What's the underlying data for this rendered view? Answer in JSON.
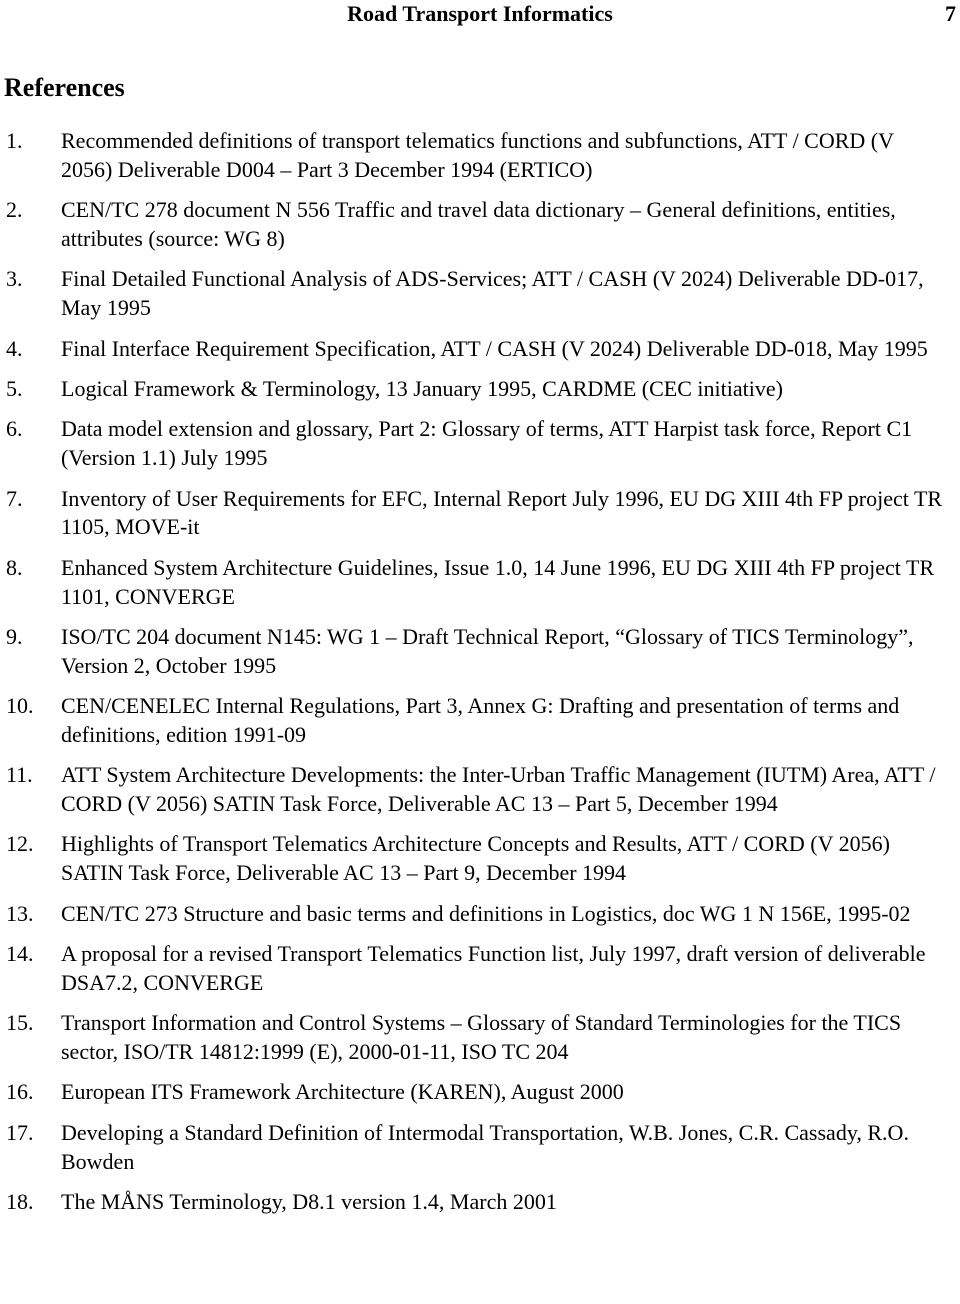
{
  "header": {
    "title": "Road Transport Informatics",
    "page_number": "7"
  },
  "section": {
    "heading": "References"
  },
  "references": [
    {
      "num": "1.",
      "text": "Recommended definitions of transport telematics functions and subfunctions, ATT / CORD (V 2056) Deliverable D004 – Part 3 December 1994 (ERTICO)"
    },
    {
      "num": "2.",
      "text": "CEN/TC 278 document N 556 Traffic and travel data dictionary – General definitions, entities, attributes (source: WG 8)"
    },
    {
      "num": "3.",
      "text": "Final Detailed Functional Analysis of ADS-Services; ATT / CASH (V 2024) Deliverable DD-017, May 1995"
    },
    {
      "num": "4.",
      "text": "Final Interface Requirement Specification, ATT / CASH (V 2024) Deliverable DD-018, May 1995"
    },
    {
      "num": "5.",
      "text": "Logical Framework & Terminology, 13 January 1995, CARDME (CEC initiative)"
    },
    {
      "num": "6.",
      "text": "Data model extension and glossary, Part 2: Glossary of terms, ATT Harpist task force, Report C1 (Version 1.1) July 1995"
    },
    {
      "num": "7.",
      "text": "Inventory of User Requirements for EFC, Internal Report July 1996, EU DG XIII 4th FP project TR 1105, MOVE-it"
    },
    {
      "num": "8.",
      "text": "Enhanced System Architecture Guidelines, Issue 1.0, 14 June 1996, EU DG XIII 4th FP project TR 1101, CONVERGE"
    },
    {
      "num": "9.",
      "text": "ISO/TC 204 document N145: WG 1 – Draft Technical Report, “Glossary of TICS Terminology”, Version 2, October 1995"
    },
    {
      "num": "10.",
      "text": "CEN/CENELEC Internal Regulations, Part 3, Annex G: Drafting and presentation of terms and definitions, edition 1991-09"
    },
    {
      "num": "11.",
      "text": "ATT System Architecture Developments: the Inter-Urban Traffic Management (IUTM) Area, ATT / CORD (V 2056) SATIN Task Force, Deliverable AC 13 – Part 5, December 1994"
    },
    {
      "num": "12.",
      "text": "Highlights of Transport Telematics Architecture Concepts and Results, ATT / CORD (V 2056) SATIN Task Force, Deliverable AC 13 – Part 9, December 1994"
    },
    {
      "num": "13.",
      "text": "CEN/TC 273 Structure and basic terms and definitions in Logistics, doc WG 1 N 156E, 1995-02"
    },
    {
      "num": "14.",
      "text": "A proposal for a revised Transport Telematics Function list, July 1997, draft version of deliverable DSA7.2, CONVERGE"
    },
    {
      "num": "15.",
      "text": "Transport Information and Control Systems – Glossary of Standard Terminologies for the TICS sector, ISO/TR 14812:1999 (E), 2000-01-11, ISO TC 204"
    },
    {
      "num": "16.",
      "text": "European ITS Framework Architecture (KAREN), August 2000"
    },
    {
      "num": "17.",
      "text": "Developing a Standard Definition of Intermodal Transportation, W.B. Jones, C.R. Cassady, R.O. Bowden"
    },
    {
      "num": "18.",
      "text": "The MÅNS Terminology, D8.1 version 1.4, March 2001"
    }
  ]
}
